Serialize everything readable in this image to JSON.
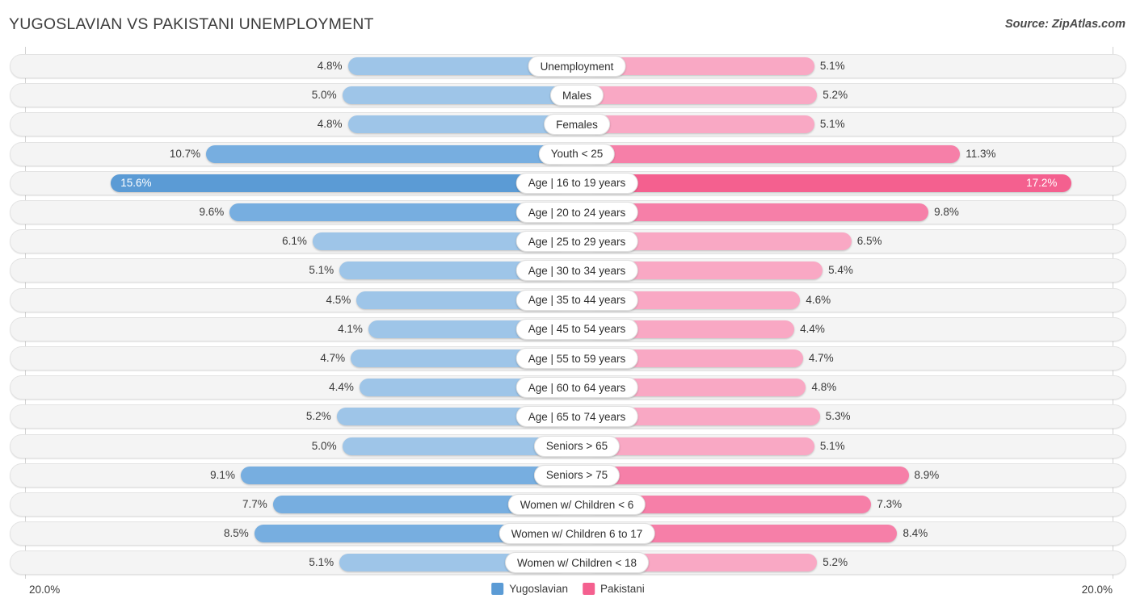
{
  "header": {
    "title": "YUGOSLAVIAN VS PAKISTANI UNEMPLOYMENT",
    "source": "Source: ZipAtlas.com"
  },
  "legend": {
    "left": {
      "label": "Yugoslavian",
      "color": "#5b9bd5"
    },
    "right": {
      "label": "Pakistani",
      "color": "#f4608f"
    }
  },
  "axis": {
    "left_max_label": "20.0%",
    "right_max_label": "20.0%",
    "max_value": 20.0
  },
  "colors": {
    "left_light": "#9ec5e8",
    "left_dark": "#5b9bd5",
    "right_light": "#f9a8c4",
    "right_dark": "#f4608f",
    "track": "#f4f4f4",
    "track_border": "#e3e3e3",
    "pill_bg": "#ffffff",
    "text": "#3a3a3a"
  },
  "chart_data": {
    "type": "bar",
    "orientation": "horizontal-diverging",
    "title": "YUGOSLAVIAN VS PAKISTANI UNEMPLOYMENT",
    "xlabel": "",
    "ylabel": "",
    "xlim": [
      20.0,
      20.0
    ],
    "grid": false,
    "legend_position": "bottom-center",
    "series": [
      {
        "name": "Yugoslavian",
        "side": "left",
        "color": "#5b9bd5",
        "values": [
          4.8,
          5.0,
          4.8,
          10.7,
          15.6,
          9.6,
          6.1,
          5.1,
          4.5,
          4.1,
          4.7,
          4.4,
          5.2,
          5.0,
          9.1,
          7.7,
          8.5,
          5.1
        ]
      },
      {
        "name": "Pakistani",
        "side": "right",
        "color": "#f4608f",
        "values": [
          5.1,
          5.2,
          5.1,
          11.3,
          17.2,
          9.8,
          6.5,
          5.4,
          4.6,
          4.4,
          4.7,
          4.8,
          5.3,
          5.1,
          8.9,
          7.3,
          8.4,
          5.2
        ]
      }
    ],
    "categories": [
      "Unemployment",
      "Males",
      "Females",
      "Youth < 25",
      "Age | 16 to 19 years",
      "Age | 20 to 24 years",
      "Age | 25 to 29 years",
      "Age | 30 to 34 years",
      "Age | 35 to 44 years",
      "Age | 45 to 54 years",
      "Age | 55 to 59 years",
      "Age | 60 to 64 years",
      "Age | 65 to 74 years",
      "Seniors > 65",
      "Seniors > 75",
      "Women w/ Children < 6",
      "Women w/ Children 6 to 17",
      "Women w/ Children < 18"
    ]
  },
  "rows": [
    {
      "category": "Unemployment",
      "left_value": 4.8,
      "left_label": "4.8%",
      "right_value": 5.1,
      "right_label": "5.1%",
      "left_shade": "light",
      "right_shade": "light",
      "left_inside": false,
      "right_inside": false
    },
    {
      "category": "Males",
      "left_value": 5.0,
      "left_label": "5.0%",
      "right_value": 5.2,
      "right_label": "5.2%",
      "left_shade": "light",
      "right_shade": "light",
      "left_inside": false,
      "right_inside": false
    },
    {
      "category": "Females",
      "left_value": 4.8,
      "left_label": "4.8%",
      "right_value": 5.1,
      "right_label": "5.1%",
      "left_shade": "light",
      "right_shade": "light",
      "left_inside": false,
      "right_inside": false
    },
    {
      "category": "Youth < 25",
      "left_value": 10.7,
      "left_label": "10.7%",
      "right_value": 11.3,
      "right_label": "11.3%",
      "left_shade": "mid",
      "right_shade": "mid",
      "left_inside": false,
      "right_inside": false
    },
    {
      "category": "Age | 16 to 19 years",
      "left_value": 15.6,
      "left_label": "15.6%",
      "right_value": 17.2,
      "right_label": "17.2%",
      "left_shade": "dark",
      "right_shade": "dark",
      "left_inside": true,
      "right_inside": true
    },
    {
      "category": "Age | 20 to 24 years",
      "left_value": 9.6,
      "left_label": "9.6%",
      "right_value": 9.8,
      "right_label": "9.8%",
      "left_shade": "mid",
      "right_shade": "mid",
      "left_inside": false,
      "right_inside": false
    },
    {
      "category": "Age | 25 to 29 years",
      "left_value": 6.1,
      "left_label": "6.1%",
      "right_value": 6.5,
      "right_label": "6.5%",
      "left_shade": "light",
      "right_shade": "light",
      "left_inside": false,
      "right_inside": false
    },
    {
      "category": "Age | 30 to 34 years",
      "left_value": 5.1,
      "left_label": "5.1%",
      "right_value": 5.4,
      "right_label": "5.4%",
      "left_shade": "light",
      "right_shade": "light",
      "left_inside": false,
      "right_inside": false
    },
    {
      "category": "Age | 35 to 44 years",
      "left_value": 4.5,
      "left_label": "4.5%",
      "right_value": 4.6,
      "right_label": "4.6%",
      "left_shade": "light",
      "right_shade": "light",
      "left_inside": false,
      "right_inside": false
    },
    {
      "category": "Age | 45 to 54 years",
      "left_value": 4.1,
      "left_label": "4.1%",
      "right_value": 4.4,
      "right_label": "4.4%",
      "left_shade": "light",
      "right_shade": "light",
      "left_inside": false,
      "right_inside": false
    },
    {
      "category": "Age | 55 to 59 years",
      "left_value": 4.7,
      "left_label": "4.7%",
      "right_value": 4.7,
      "right_label": "4.7%",
      "left_shade": "light",
      "right_shade": "light",
      "left_inside": false,
      "right_inside": false
    },
    {
      "category": "Age | 60 to 64 years",
      "left_value": 4.4,
      "left_label": "4.4%",
      "right_value": 4.8,
      "right_label": "4.8%",
      "left_shade": "light",
      "right_shade": "light",
      "left_inside": false,
      "right_inside": false
    },
    {
      "category": "Age | 65 to 74 years",
      "left_value": 5.2,
      "left_label": "5.2%",
      "right_value": 5.3,
      "right_label": "5.3%",
      "left_shade": "light",
      "right_shade": "light",
      "left_inside": false,
      "right_inside": false
    },
    {
      "category": "Seniors > 65",
      "left_value": 5.0,
      "left_label": "5.0%",
      "right_value": 5.1,
      "right_label": "5.1%",
      "left_shade": "light",
      "right_shade": "light",
      "left_inside": false,
      "right_inside": false
    },
    {
      "category": "Seniors > 75",
      "left_value": 9.1,
      "left_label": "9.1%",
      "right_value": 8.9,
      "right_label": "8.9%",
      "left_shade": "mid",
      "right_shade": "mid",
      "left_inside": false,
      "right_inside": false
    },
    {
      "category": "Women w/ Children < 6",
      "left_value": 7.7,
      "left_label": "7.7%",
      "right_value": 7.3,
      "right_label": "7.3%",
      "left_shade": "mid",
      "right_shade": "mid",
      "left_inside": false,
      "right_inside": false
    },
    {
      "category": "Women w/ Children 6 to 17",
      "left_value": 8.5,
      "left_label": "8.5%",
      "right_value": 8.4,
      "right_label": "8.4%",
      "left_shade": "mid",
      "right_shade": "mid",
      "left_inside": false,
      "right_inside": false
    },
    {
      "category": "Women w/ Children < 18",
      "left_value": 5.1,
      "left_label": "5.1%",
      "right_value": 5.2,
      "right_label": "5.2%",
      "left_shade": "light",
      "right_shade": "light",
      "left_inside": false,
      "right_inside": false
    }
  ]
}
